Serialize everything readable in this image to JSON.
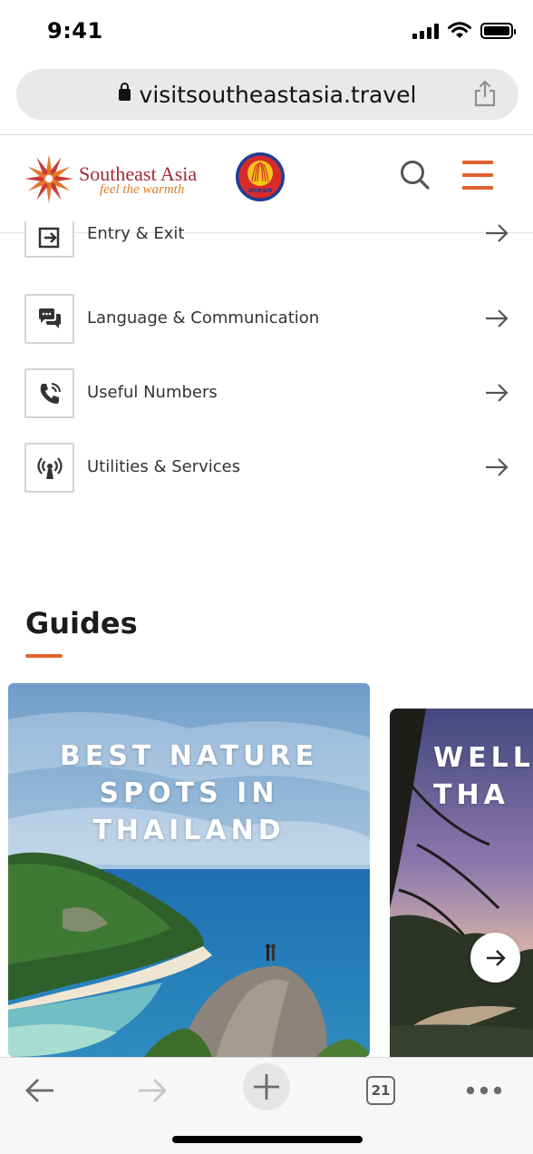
{
  "status_bar": {
    "time": "9:41"
  },
  "browser": {
    "url": "visitsoutheastasia.travel"
  },
  "site_header": {
    "brand_name": "Southeast Asia",
    "brand_tagline": "feel the warmth",
    "asean_text": "asean",
    "accent_color": "#e0622c",
    "brand_color": "#a32a36"
  },
  "info_items": [
    {
      "label": "Entry & Exit",
      "icon": "exit-icon"
    },
    {
      "label": "Language & Communication",
      "icon": "chat-bubbles-icon"
    },
    {
      "label": "Useful Numbers",
      "icon": "phone-icon"
    },
    {
      "label": "Utilities & Services",
      "icon": "broadcast-icon"
    }
  ],
  "guides": {
    "title": "Guides",
    "cards": [
      {
        "title": "BEST NATURE SPOTS IN THAILAND"
      },
      {
        "title": "WELL\nTHA"
      }
    ]
  },
  "toolbar": {
    "tab_count": "21"
  }
}
